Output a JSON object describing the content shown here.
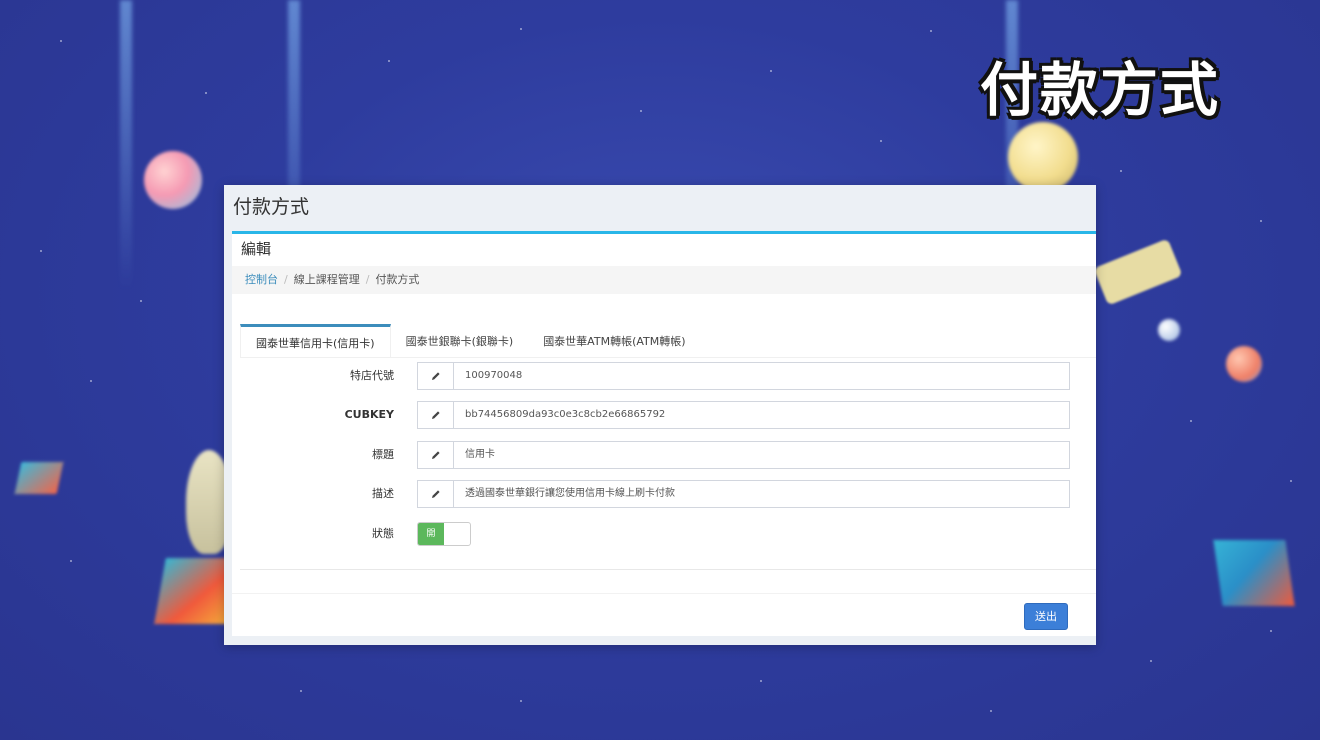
{
  "banner": {
    "title": "付款方式"
  },
  "card": {
    "header": "付款方式",
    "box_title": "編輯",
    "breadcrumb": [
      "控制台",
      "線上課程管理",
      "付款方式"
    ]
  },
  "tabs": [
    {
      "label": "國泰世華信用卡(信用卡)",
      "active": true
    },
    {
      "label": "國泰世銀聯卡(銀聯卡)",
      "active": false
    },
    {
      "label": "國泰世華ATM轉帳(ATM轉帳)",
      "active": false
    }
  ],
  "form": {
    "store_code": {
      "label": "特店代號",
      "value": "100970048"
    },
    "cubkey": {
      "label": "CUBKEY",
      "value": "bb74456809da93c0e3c8cb2e66865792"
    },
    "title": {
      "label": "標題",
      "value": "信用卡"
    },
    "description": {
      "label": "描述",
      "value": "透過國泰世華銀行讓您使用信用卡線上刷卡付款"
    },
    "status": {
      "label": "狀態",
      "toggle_label": "開",
      "on": true
    }
  },
  "actions": {
    "submit_label": "送出"
  },
  "colors": {
    "accent": "#29b6e8",
    "link": "#3c8dbc",
    "toggle_on": "#5cb85c",
    "submit": "#3c7fd8"
  },
  "icons": {
    "field_addon": "pencil-icon"
  }
}
